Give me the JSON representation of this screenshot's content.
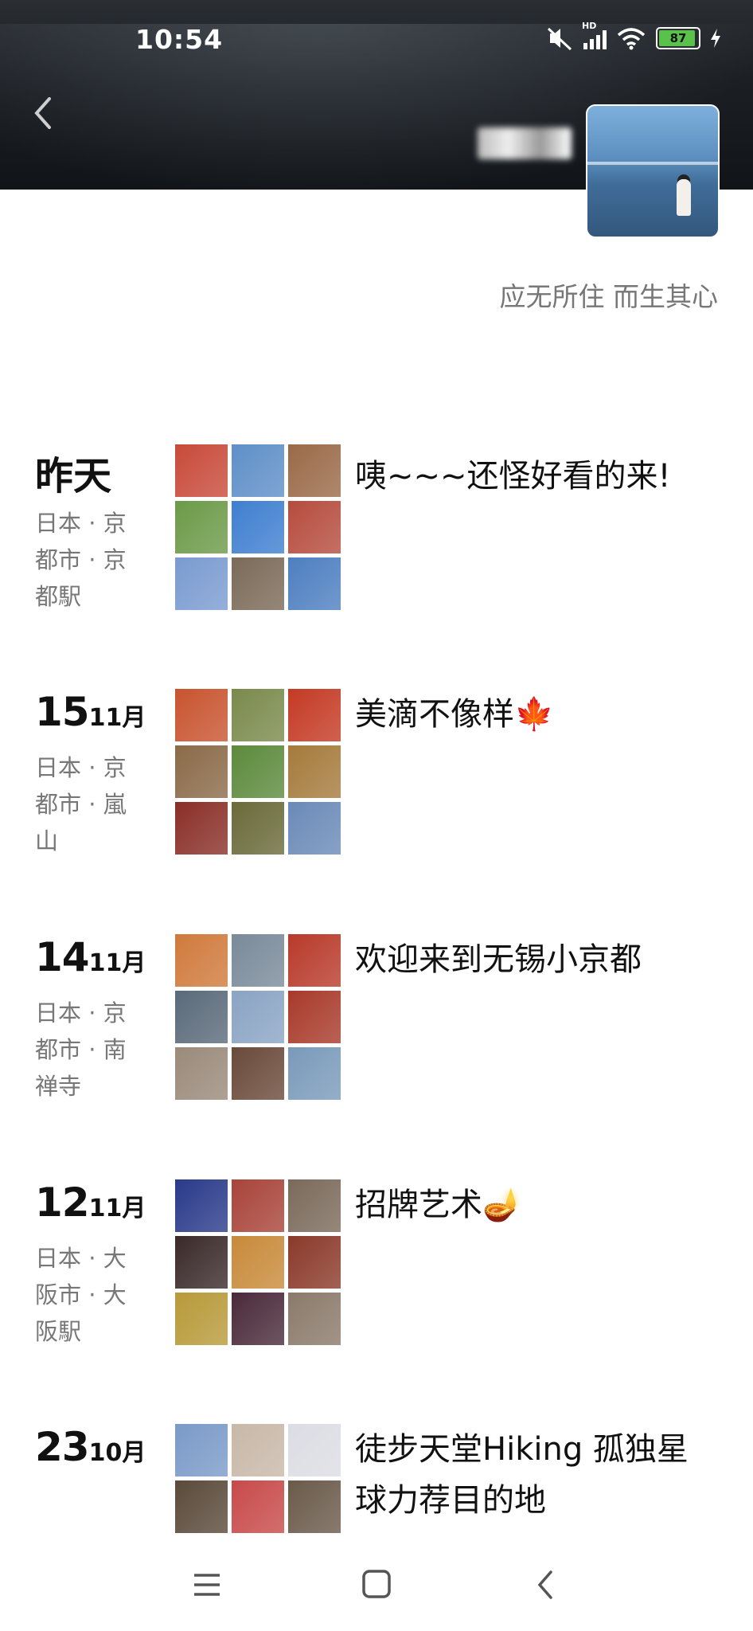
{
  "status_bar": {
    "time": "10:54",
    "battery": "87",
    "network": "HD",
    "wifi_sub": "6"
  },
  "profile": {
    "signature": "应无所住 而生其心"
  },
  "posts": [
    {
      "date": "昨天",
      "location": "日本 · 京都市 · 京都駅",
      "caption": "咦~~~还怪好看的来!",
      "thumbs": [
        "#c84a3a",
        "#5e8fc8",
        "#9a6a48",
        "#6c9a48",
        "#3f7fd0",
        "#b64c3e",
        "#7a9bd0",
        "#7b6a58",
        "#4d7fc0"
      ]
    },
    {
      "day": "15",
      "month": "11月",
      "location": "日本 · 京都市 · 嵐山",
      "caption": "美滴不像样🍁",
      "thumbs": [
        "#c8542f",
        "#7a8a4c",
        "#c43a24",
        "#8a6a48",
        "#5c8a3c",
        "#a57a3c",
        "#8a2f28",
        "#6a6a3a",
        "#6a8ab8"
      ]
    },
    {
      "day": "14",
      "month": "11月",
      "location": "日本 · 京都市 · 南禅寺",
      "caption": "欢迎来到无锡小京都",
      "thumbs": [
        "#d07a3c",
        "#7a8a9a",
        "#b83a2a",
        "#5a6a7a",
        "#8aa4c4",
        "#a83a2a",
        "#9a8a7a",
        "#6a4a3a",
        "#7a9aba"
      ]
    },
    {
      "day": "12",
      "month": "11月",
      "location": "日本 · 大阪市 · 大阪駅",
      "caption": "招牌艺术🪔",
      "thumbs": [
        "#2a3a8a",
        "#a8443a",
        "#7a6a5a",
        "#3a2a2a",
        "#c88a3a",
        "#8a3a2a",
        "#b89a3a",
        "#4a2a3a",
        "#8a7a6a"
      ]
    },
    {
      "day": "23",
      "month": "10月",
      "location": "",
      "caption": "徒步天堂Hiking 孤独星球力荐目的地",
      "thumbs": [
        "#7a9ac8",
        "#c8b8a8",
        "#dcdce4",
        "#5a4a3a",
        "#c84a4a",
        "#6a5a4a",
        "#c83a3a",
        "#d8a8a8",
        "#8a8a9a"
      ]
    }
  ]
}
